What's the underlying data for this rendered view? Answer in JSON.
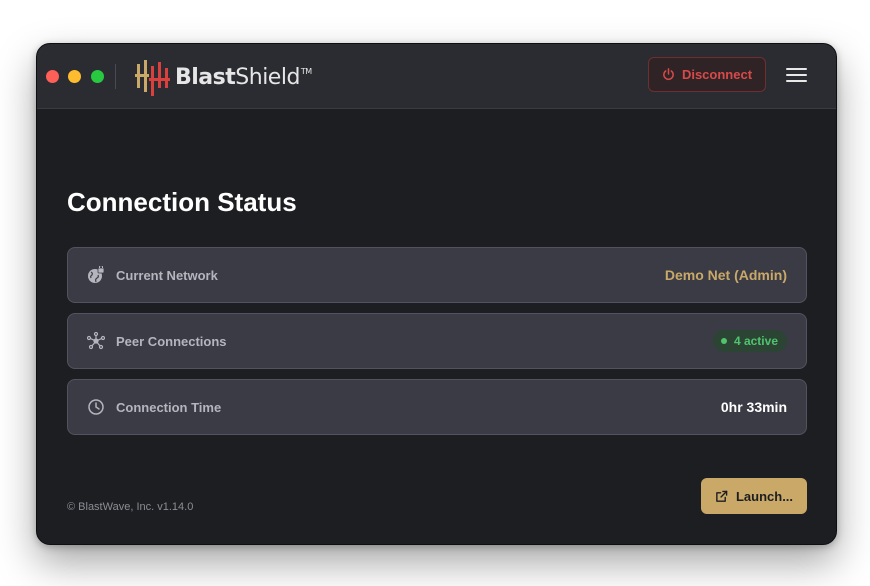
{
  "app": {
    "logo_text_bold": "Blast",
    "logo_text_regular": "Shield",
    "logo_trademark": "TM"
  },
  "header": {
    "disconnect_label": "Disconnect",
    "disconnect_icon": "power-icon",
    "menu_icon": "hamburger-menu-icon"
  },
  "main": {
    "title": "Connection Status",
    "rows": [
      {
        "icon": "globe-lock-icon",
        "label": "Current Network",
        "value": "Demo Net (Admin)"
      },
      {
        "icon": "network-nodes-icon",
        "label": "Peer Connections",
        "value": "4 active"
      },
      {
        "icon": "clock-icon",
        "label": "Connection Time",
        "value": "0hr 33min"
      }
    ]
  },
  "footer": {
    "copyright": "© BlastWave, Inc. v1.14.0"
  },
  "actions": {
    "launch_label": "Launch...",
    "launch_icon": "external-link-icon"
  },
  "colors": {
    "accent_gold": "#c9a868",
    "danger_red": "#d84a4a",
    "success_green": "#4fc46d",
    "background": "#1d1e22",
    "card": "#3a3b45"
  }
}
